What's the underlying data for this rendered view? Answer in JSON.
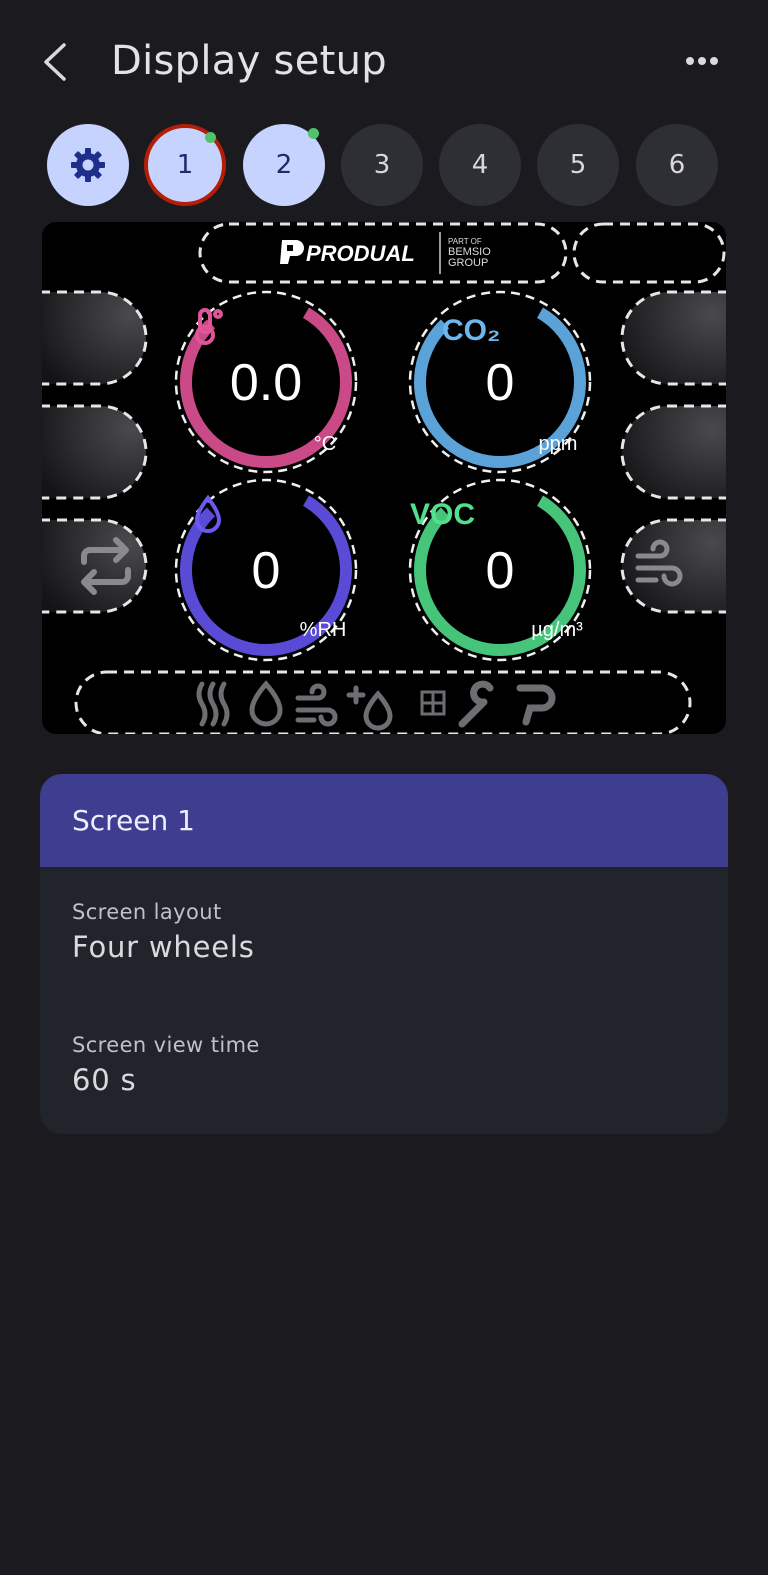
{
  "header": {
    "title": "Display setup"
  },
  "tabs": [
    {
      "label": "",
      "icon": "gear-icon",
      "active": true,
      "dot": false
    },
    {
      "label": "1",
      "active": true,
      "selected": true,
      "dot": true
    },
    {
      "label": "2",
      "active": true,
      "dot": true
    },
    {
      "label": "3",
      "active": false,
      "dot": false
    },
    {
      "label": "4",
      "active": false,
      "dot": false
    },
    {
      "label": "5",
      "active": false,
      "dot": false
    },
    {
      "label": "6",
      "active": false,
      "dot": false
    }
  ],
  "preview": {
    "brand": {
      "name": "PRODUAL",
      "sub1": "PART OF",
      "sub2": "BEMSIO",
      "sub3": "GROUP"
    },
    "gauges": [
      {
        "id": "temperature",
        "value": "0.0",
        "unit": "°C",
        "icon": "thermometer-icon",
        "color": "#c94a86"
      },
      {
        "id": "co2",
        "value": "0",
        "unit": "ppm",
        "label": "CO₂",
        "color": "#5aa2d8"
      },
      {
        "id": "humidity",
        "value": "0",
        "unit": "%RH",
        "icon": "droplet-icon",
        "color": "#5a4bd6"
      },
      {
        "id": "voc",
        "value": "0",
        "unit": "µg/m³",
        "label": "VOC",
        "color": "#45c47a"
      }
    ]
  },
  "card": {
    "title": "Screen 1",
    "layout_label": "Screen layout",
    "layout_value": "Four wheels",
    "time_label": "Screen view time",
    "time_value": "60 s"
  },
  "colors": {
    "background": "#1b1b1f",
    "accent": "#3e3d90",
    "tab_active": "#c7d3ff",
    "selected_ring": "#b21e07",
    "status_dot": "#4fc36b"
  }
}
